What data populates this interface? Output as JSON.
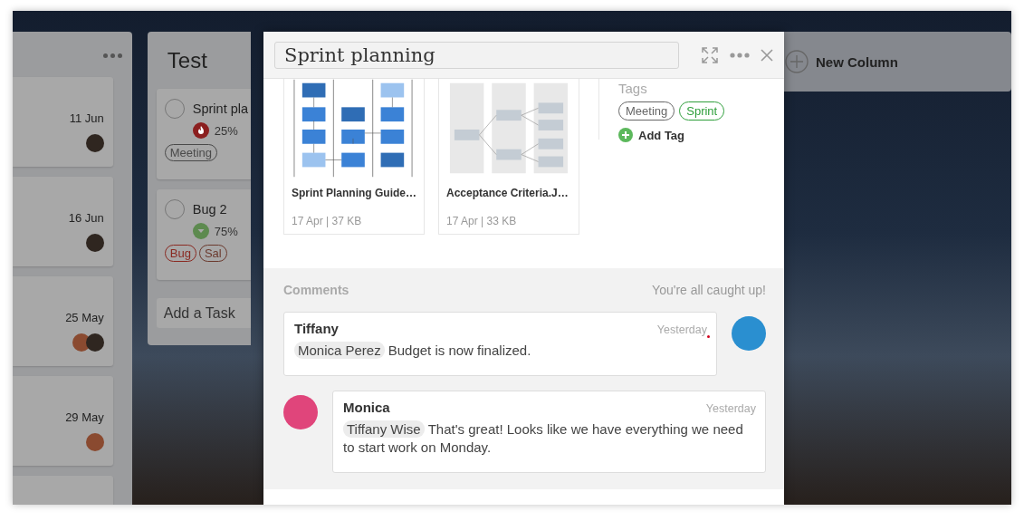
{
  "board": {
    "columns": [
      {
        "kind": "partial",
        "cards": [
          {
            "kind": "dated",
            "date": "11 Jun",
            "avatars": [
              {
                "color": "#2f2620"
              }
            ]
          },
          {
            "kind": "dated",
            "date": "16 Jun",
            "avatars": [
              {
                "color": "#2f2620"
              }
            ]
          },
          {
            "kind": "dated",
            "date": "25 May",
            "avatars": [
              {
                "color": "#8a4a30"
              },
              {
                "color": "#2f2620"
              }
            ]
          },
          {
            "kind": "dated",
            "date": "29 May",
            "avatars": [
              {
                "color": "#8a4a30"
              }
            ]
          },
          {
            "kind": "stub"
          }
        ]
      },
      {
        "kind": "list",
        "title": "Test",
        "cards": [
          {
            "title": "Sprint pla",
            "checked": false,
            "priority": {
              "kind": "high"
            },
            "progress": "25%",
            "tags": [
              {
                "label": "Meeting",
                "color": "#4a4a4a"
              }
            ]
          },
          {
            "title": "Bug 2",
            "checked": false,
            "priority": {
              "kind": "low"
            },
            "progress": "75%",
            "tags": [
              {
                "label": "Bug",
                "color": "#8a2a22"
              },
              {
                "label": "Sal",
                "color": "#6b3a2e"
              }
            ]
          }
        ],
        "add_task": "Add a Task"
      }
    ],
    "new_column": "New Column"
  },
  "modal": {
    "title": "Sprint planning",
    "attachments": [
      {
        "name": "Sprint Planning Guide…",
        "meta": "17 Apr | 37 KB",
        "kind": "flowchart"
      },
      {
        "name": "Acceptance Criteria.J…",
        "meta": "17 Apr | 33 KB",
        "kind": "tree"
      }
    ],
    "tags_label": "Tags",
    "tags": [
      {
        "label": "Meeting",
        "color": "#666666"
      },
      {
        "label": "Sprint",
        "color": "#2e9e3a"
      }
    ],
    "add_tag": "Add Tag",
    "comments": {
      "heading": "Comments",
      "status": "You're all caught up!",
      "items": [
        {
          "kind": "right",
          "author": "Tiffany",
          "time": "Yesterday",
          "mention": "Monica  Perez",
          "text": "Budget is now finalized.",
          "unread": true,
          "avatar": {
            "color": "#2a8fd0"
          }
        },
        {
          "kind": "left",
          "author": "Monica",
          "time": "Yesterday",
          "mention": "Tiffany Wise",
          "text": "That's great! Looks like we have everything we need to start work on Monday.",
          "unread": false,
          "avatar": {
            "color": "#e0457b"
          }
        }
      ]
    }
  }
}
